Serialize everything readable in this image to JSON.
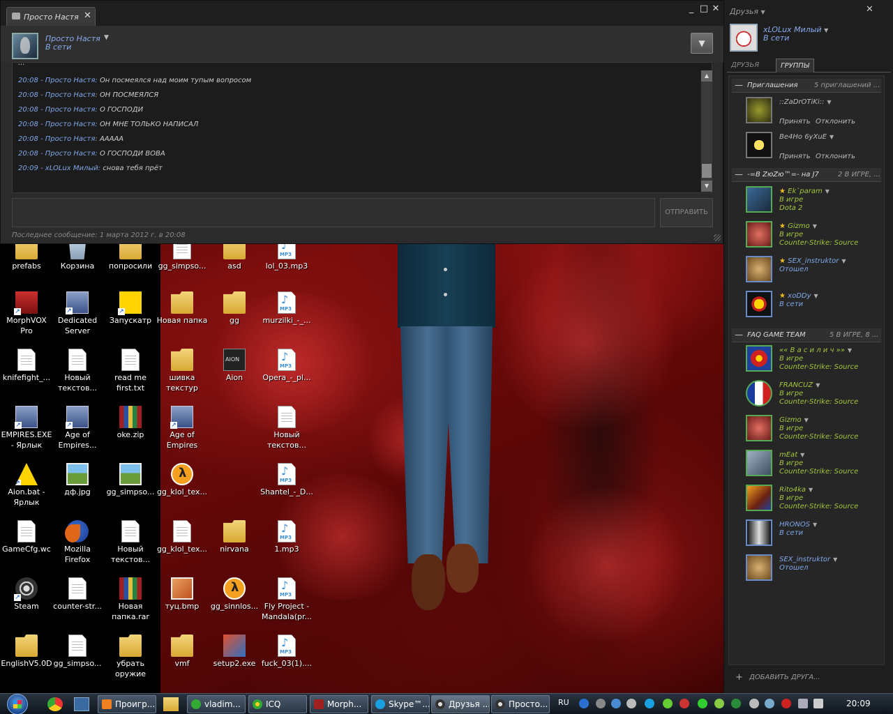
{
  "chat": {
    "tab_title": "Просто Настя",
    "contact_name": "Просто Настя",
    "contact_status": "В сети",
    "messages": [
      {
        "meta": "20:08 - Просто Настя:",
        "text": "Он посмеялся над моим тупым вопросом"
      },
      {
        "meta": "20:08 - Просто Настя:",
        "text": "ОН ПОСМЕЯЛСЯ"
      },
      {
        "meta": "20:08 - Просто Настя:",
        "text": "О ГОСПОДИ"
      },
      {
        "meta": "20:08 - Просто Настя:",
        "text": "ОН МНЕ ТОЛЬКО НАПИСАЛ"
      },
      {
        "meta": "20:08 - Просто Настя:",
        "text": "ААААА"
      },
      {
        "meta": "20:08 - Просто Настя:",
        "text": "О ГОСПОДИ ВОВА"
      },
      {
        "meta": "20:09 - xLOLux Милый:",
        "text": "снова тебя прёт"
      }
    ],
    "send_label": "ОТПРАВИТЬ",
    "last_message": "Последнее сообщение: 1 марта 2012 г. в 20:08"
  },
  "friends": {
    "title": "Друзья",
    "me_name": "xLOLux Милый",
    "me_status": "В сети",
    "tab_friends": "ДРУЗЬЯ",
    "tab_groups": "ГРУППЫ",
    "accept_label": "Принять",
    "decline_label": "Отклонить",
    "add_friend": "ДОБАВИТЬ ДРУГА...",
    "groups": [
      {
        "name": "Приглашения",
        "count": "5 приглашений ..."
      },
      {
        "name": "-=В ZюZю™=- на J7",
        "count": "2 В ИГРЕ, ..."
      },
      {
        "name": "FAQ GAME TEAM",
        "count": "5 В ИГРЕ, 8 ..."
      }
    ],
    "invites": [
      {
        "name": "::ZaDrOTiKi::"
      },
      {
        "name": "Be4Ho 6yXuE"
      }
    ],
    "zuzu": [
      {
        "name": "Ek`param",
        "status": "В игре",
        "game": "Dota 2",
        "star": "★"
      },
      {
        "name": "Gizmo",
        "status": "В игре",
        "game": "Counter-Strike: Source",
        "star": "★"
      },
      {
        "name": "SEX_instruktor",
        "status": "Отошел",
        "game": "",
        "star": "★"
      },
      {
        "name": "xoDDy",
        "status": "В сети",
        "game": "",
        "star": "★"
      }
    ],
    "faq": [
      {
        "name": "«« В а с и л и ч »»",
        "status": "В игре",
        "game": "Counter-Strike: Source"
      },
      {
        "name": "FRANCUZ",
        "status": "В игре",
        "game": "Counter-Strike: Source"
      },
      {
        "name": "Gizmo",
        "status": "В игре",
        "game": "Counter-Strike: Source"
      },
      {
        "name": "mEat",
        "status": "В игре",
        "game": "Counter-Strike: Source"
      },
      {
        "name": "Rito4ka",
        "status": "В игре",
        "game": "Counter-Strike: Source"
      },
      {
        "name": "HRONOS",
        "status": "В сети",
        "game": ""
      },
      {
        "name": "SEX_instruktor",
        "status": "Отошел",
        "game": ""
      }
    ]
  },
  "desktop": {
    "icons": [
      "prefabs",
      "Корзина",
      "попросили",
      "gg_simpso...",
      "asd",
      "lol_03.mp3",
      "MorphVOX Pro",
      "Dedicated Server",
      "Запускатр",
      "Новая папка",
      "gg",
      "murzilki_-_...",
      "knifefight_...",
      "Новый текстов...",
      "read me first.txt",
      "шивка текстур",
      "Aion",
      "Opera_-_pl...",
      "EMPIRES.EXE - Ярлык",
      "Age of Empires...",
      "oke.zip",
      "Age of Empires",
      "Новый текстов...",
      "Aion.bat - Ярлык",
      "дф.jpg",
      "gg_simpso...",
      "gg_klol_tex...",
      "Shantel_-_D...",
      "GameCfg.wc",
      "Mozilla Firefox",
      "Новый текстов...",
      "gg_klol_tex...",
      "nirvana",
      "1.mp3",
      "Steam",
      "counter-str...",
      "Новая папка.rar",
      "туц.bmp",
      "gg_sinnlos...",
      "Fly Project - Mandala(pr...",
      "EnglishV5.0D",
      "gg_simpso...",
      "убрать оружие",
      "vmf",
      "setup2.exe",
      "fuck_03(1)...."
    ]
  },
  "taskbar": {
    "items": [
      "Проигр...",
      "vladim...",
      "ICQ",
      "Morph...",
      "Skype™...",
      "Друзья ...",
      "Просто..."
    ],
    "lang": "RU",
    "clock": "20:09"
  }
}
